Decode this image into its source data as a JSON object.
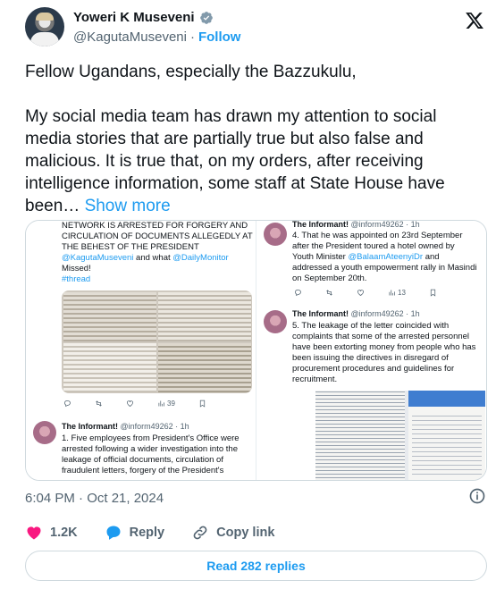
{
  "author": {
    "name": "Yoweri K Museveni",
    "handle": "@KagutaMuseveni",
    "separator": "·",
    "follow_label": "Follow"
  },
  "tweet": {
    "paragraph1": "Fellow Ugandans, especially the Bazzukulu,",
    "paragraph2": "My social media team has drawn my attention to social media stories that are partially true but also false and malicious. It is true that, on my orders, after receiving intelligence information, some staff at State House have been…",
    "show_more": "Show more"
  },
  "media": {
    "left_top_text": "NETWORK IS ARRESTED FOR FORGERY AND CIRCULATION OF DOCUMENTS ALLEGEDLY AT THE BEHEST OF THE PRESIDENT",
    "left_top_link1": "@KagutaMuseveni",
    "left_top_mid": " and what ",
    "left_top_link2": "@DailyMonitor",
    "left_top_missed": "Missed!",
    "left_top_hashtag": "#thread",
    "left_stats": {
      "views": "39"
    },
    "left_tweet": {
      "name": "The Informant!",
      "meta": "@inform49262 · 1h",
      "body": "1. Five employees from President's Office were arrested following a wider investigation into the leakage of official documents, circulation of fraudulent letters, forgery of the President's"
    },
    "right_tweet1": {
      "name": "The Informant!",
      "meta": "@inform49262 · 1h",
      "body": "4. That he was appointed on 23rd September after the President toured a hotel owned by Youth Minister ",
      "link": "@BalaamAteenyiDr",
      "body_end": " and addressed a youth empowerment rally in Masindi on September 20th.",
      "views": "13"
    },
    "right_tweet2": {
      "name": "The Informant!",
      "meta": "@inform49262 · 1h",
      "body": "5. The leakage of the letter coincided with complaints that some of the arrested personnel have been extorting money from people who has been issuing the directives in disregard of procurement procedures and guidelines for recruitment."
    }
  },
  "timestamp": "6:04 PM · Oct 21, 2024",
  "engagement": {
    "likes": "1.2K",
    "reply_label": "Reply",
    "copy_link_label": "Copy link"
  },
  "read_replies_label": "Read 282 replies",
  "colors": {
    "accent": "#1d9bf0",
    "text": "#0f1419",
    "muted": "#536471",
    "like": "#f91880"
  }
}
